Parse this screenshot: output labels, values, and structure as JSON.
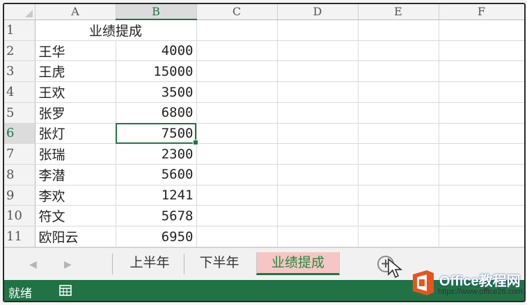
{
  "columns": [
    "A",
    "B",
    "C",
    "D",
    "E",
    "F"
  ],
  "selected_column": "B",
  "selected_row": "6",
  "rows": [
    {
      "num": "1",
      "a": "业绩提成",
      "b": ""
    },
    {
      "num": "2",
      "a": "王华",
      "b": "4000"
    },
    {
      "num": "3",
      "a": "王虎",
      "b": "15000"
    },
    {
      "num": "4",
      "a": "王欢",
      "b": "3500"
    },
    {
      "num": "5",
      "a": "张罗",
      "b": "6800"
    },
    {
      "num": "6",
      "a": "张灯",
      "b": "7500"
    },
    {
      "num": "7",
      "a": "张瑞",
      "b": "2300"
    },
    {
      "num": "8",
      "a": "李潜",
      "b": "5600"
    },
    {
      "num": "9",
      "a": "李欢",
      "b": "1241"
    },
    {
      "num": "10",
      "a": "符文",
      "b": "5678"
    },
    {
      "num": "11",
      "a": "欧阳云",
      "b": "6950"
    }
  ],
  "sheet_tabs": [
    {
      "label": "上半年",
      "active": false
    },
    {
      "label": "下半年",
      "active": false
    },
    {
      "label": "业绩提成",
      "active": true
    }
  ],
  "nav": {
    "prev": "◀",
    "next": "▶"
  },
  "add_sheet_symbol": "+",
  "status": {
    "text": "就绪"
  },
  "colors": {
    "accent": "#217346",
    "active_tab_bg": "#f6c6c6",
    "brand_orange": "#e8541e"
  },
  "icons": [
    "normal-view-icon",
    "new-sheet-plus-icon",
    "mouse-cursor-icon",
    "office-logo-icon"
  ],
  "watermark": {
    "name": "Office教程网",
    "url": "https://www.office26.com"
  }
}
